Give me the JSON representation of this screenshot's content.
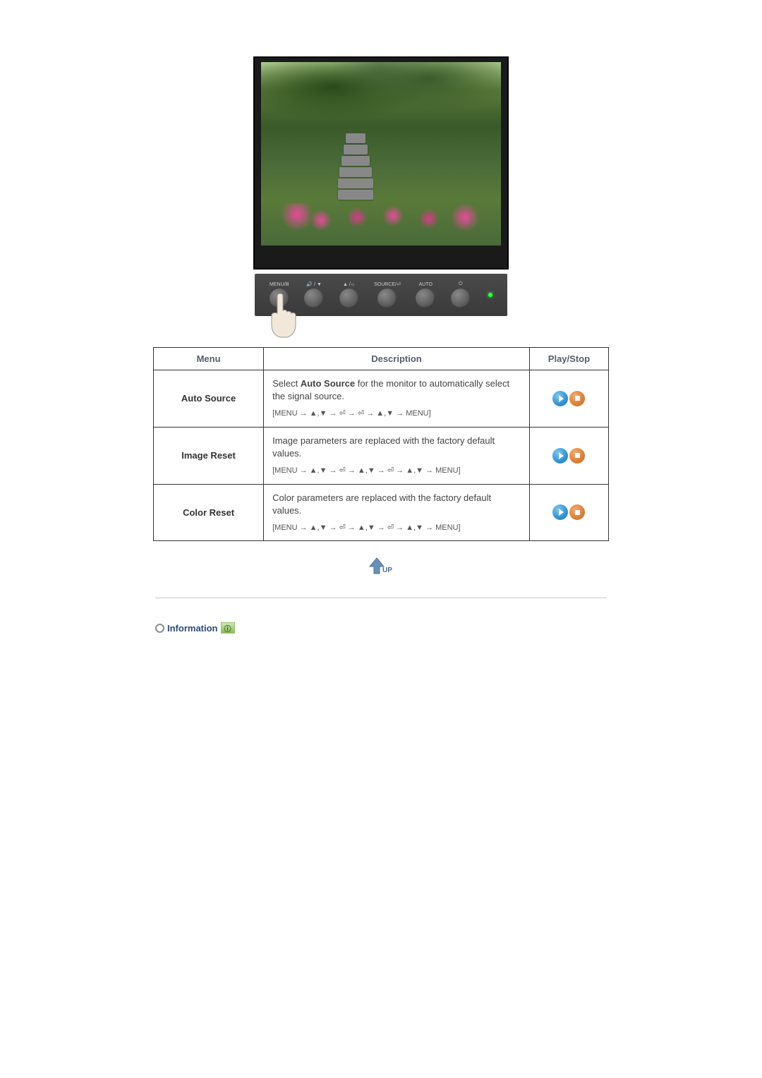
{
  "panel": {
    "buttons": [
      {
        "label": "MENU/Ⅲ"
      },
      {
        "label": "🔊 / ▼"
      },
      {
        "label": "▲ /☼"
      },
      {
        "label": "SOURCE/⏎"
      },
      {
        "label": "AUTO"
      },
      {
        "label": "⏻"
      }
    ]
  },
  "table": {
    "headers": {
      "menu": "Menu",
      "description": "Description",
      "playstop": "Play/Stop"
    },
    "rows": [
      {
        "name": "Auto Source",
        "desc_pre": "Select ",
        "desc_strong": "Auto Source",
        "desc_post": " for the monitor to automatically select the signal source.",
        "nav": "[MENU → ▲,▼ → ⏎ → ⏎ → ▲,▼ → MENU]"
      },
      {
        "name": "Image Reset",
        "desc_pre": "",
        "desc_strong": "",
        "desc_post": "Image parameters are replaced with the factory default values.",
        "nav": "[MENU → ▲,▼ → ⏎ → ▲,▼ → ⏎ → ▲,▼ → MENU]"
      },
      {
        "name": "Color Reset",
        "desc_pre": "",
        "desc_strong": "",
        "desc_post": "Color parameters are replaced with the factory default values.",
        "nav": "[MENU → ▲,▼ → ⏎ → ▲,▼ → ⏎ → ▲,▼ → MENU]"
      }
    ]
  },
  "up_label": "UP",
  "information": {
    "label": "Information",
    "badge": "ⓘ"
  }
}
